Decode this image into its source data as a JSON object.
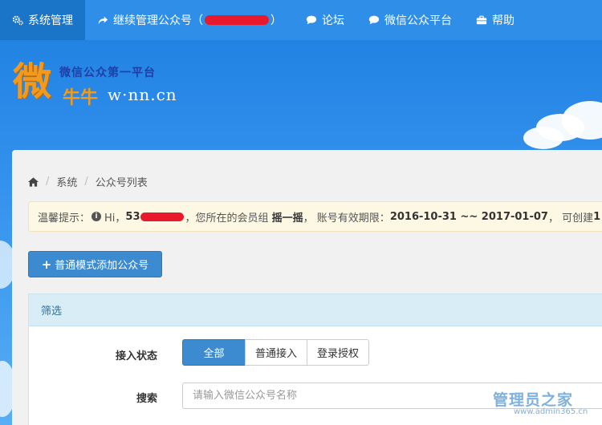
{
  "topnav": {
    "items": [
      {
        "label": "系统管理",
        "icon": "gears-icon"
      },
      {
        "label": "继续管理公众号（",
        "suffix": "）",
        "icon": "share-icon"
      },
      {
        "label": "论坛",
        "icon": "comment-icon"
      },
      {
        "label": "微信公众平台",
        "icon": "comment-icon"
      },
      {
        "label": "帮助",
        "icon": "briefcase-icon"
      }
    ]
  },
  "logo": {
    "big_char": "微",
    "slogan": "微信公众第一平台",
    "niu": "牛牛",
    "domain": "w·nn.cn"
  },
  "breadcrumb": {
    "items": [
      "系统",
      "公众号列表"
    ]
  },
  "alert": {
    "prefix": "温馨提示：",
    "hi": "Hi，",
    "user_prefix": "53",
    "group_text": "，您所在的会员组",
    "group_name": "摇一摇",
    "expiry_text": "， 账号有效期限：",
    "expiry_range": "2016-10-31 ~~ 2017-01-07",
    "create_text": "， 可创建 ",
    "create_count": "1"
  },
  "add_button": {
    "label": "普通模式添加公众号"
  },
  "filter": {
    "heading": "筛选",
    "status_label": "接入状态",
    "status_options": [
      "全部",
      "普通接入",
      "登录授权"
    ],
    "selected": "全部",
    "search_label": "搜索",
    "search_placeholder": "请输入微信公众号名称"
  },
  "watermark": {
    "cn": "管理员之家",
    "en": "www.admin365.cn"
  },
  "colors": {
    "nav_bg": "#2f8fe8",
    "nav_active": "#1a74c8",
    "primary": "#3c8bd0",
    "alert_bg": "#fcf8e3",
    "filter_head_bg": "#d9edf7",
    "logo_orange": "#f39a1e"
  }
}
